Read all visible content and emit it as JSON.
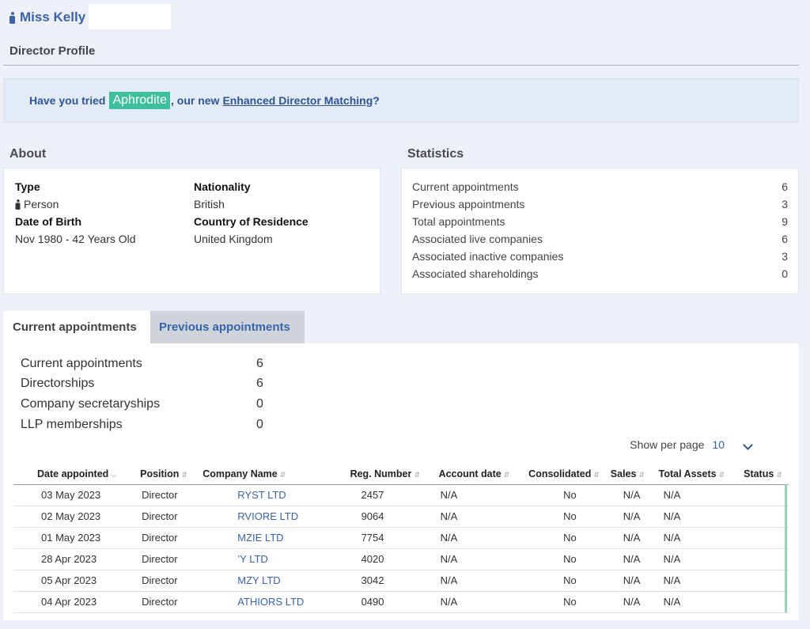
{
  "header": {
    "name": "Miss Kelly"
  },
  "profile_title": "Director Profile",
  "promo": {
    "prefix": "Have you tried",
    "brand": "Aphrodite",
    "middle": ", our new",
    "link": "Enhanced Director Matching",
    "suffix": "?"
  },
  "about": {
    "title": "About",
    "type_label": "Type",
    "type_value": "Person",
    "dob_label": "Date of Birth",
    "dob_value": "Nov 1980 - 42 Years Old",
    "nationality_label": "Nationality",
    "nationality_value": "British",
    "residence_label": "Country of Residence",
    "residence_value": "United Kingdom"
  },
  "statistics": {
    "title": "Statistics",
    "rows": [
      {
        "label": "Current appointments",
        "value": "6"
      },
      {
        "label": "Previous appointments",
        "value": "3"
      },
      {
        "label": "Total appointments",
        "value": "9"
      },
      {
        "label": "Associated live companies",
        "value": "6"
      },
      {
        "label": "Associated inactive companies",
        "value": "3"
      },
      {
        "label": "Associated shareholdings",
        "value": "0"
      }
    ]
  },
  "tabs": {
    "current": "Current appointments",
    "previous": "Previous appointments"
  },
  "summary": [
    {
      "label": "Current appointments",
      "value": "6"
    },
    {
      "label": "Directorships",
      "value": "6"
    },
    {
      "label": "Company secretaryships",
      "value": "0"
    },
    {
      "label": "LLP memberships",
      "value": "0"
    }
  ],
  "per_page": {
    "label": "Show per page",
    "value": "10"
  },
  "table": {
    "headers": {
      "date": "Date appointed",
      "position": "Position",
      "company": "Company Name",
      "reg": "Reg. Number",
      "account": "Account date",
      "consolidated": "Consolidated",
      "sales": "Sales",
      "assets": "Total Assets",
      "status": "Status"
    },
    "rows": [
      {
        "date": "03 May 2023",
        "position": "Director",
        "company": "RYST LTD",
        "reg": "2457",
        "account": "N/A",
        "consolidated": "No",
        "sales": "N/A",
        "assets": "N/A"
      },
      {
        "date": "02 May 2023",
        "position": "Director",
        "company": "RVIORE LTD",
        "reg": "9064",
        "account": "N/A",
        "consolidated": "No",
        "sales": "N/A",
        "assets": "N/A"
      },
      {
        "date": "01 May 2023",
        "position": "Director",
        "company": "MZIE LTD",
        "reg": "7754",
        "account": "N/A",
        "consolidated": "No",
        "sales": "N/A",
        "assets": "N/A"
      },
      {
        "date": "28 Apr 2023",
        "position": "Director",
        "company": "’Y LTD",
        "reg": "4020",
        "account": "N/A",
        "consolidated": "No",
        "sales": "N/A",
        "assets": "N/A"
      },
      {
        "date": "05 Apr 2023",
        "position": "Director",
        "company": "MZY LTD",
        "reg": "3042",
        "account": "N/A",
        "consolidated": "No",
        "sales": "N/A",
        "assets": "N/A"
      },
      {
        "date": "04 Apr 2023",
        "position": "Director",
        "company": "ATHIORS LTD",
        "reg": "0490",
        "account": "N/A",
        "consolidated": "No",
        "sales": "N/A",
        "assets": "N/A"
      }
    ]
  }
}
